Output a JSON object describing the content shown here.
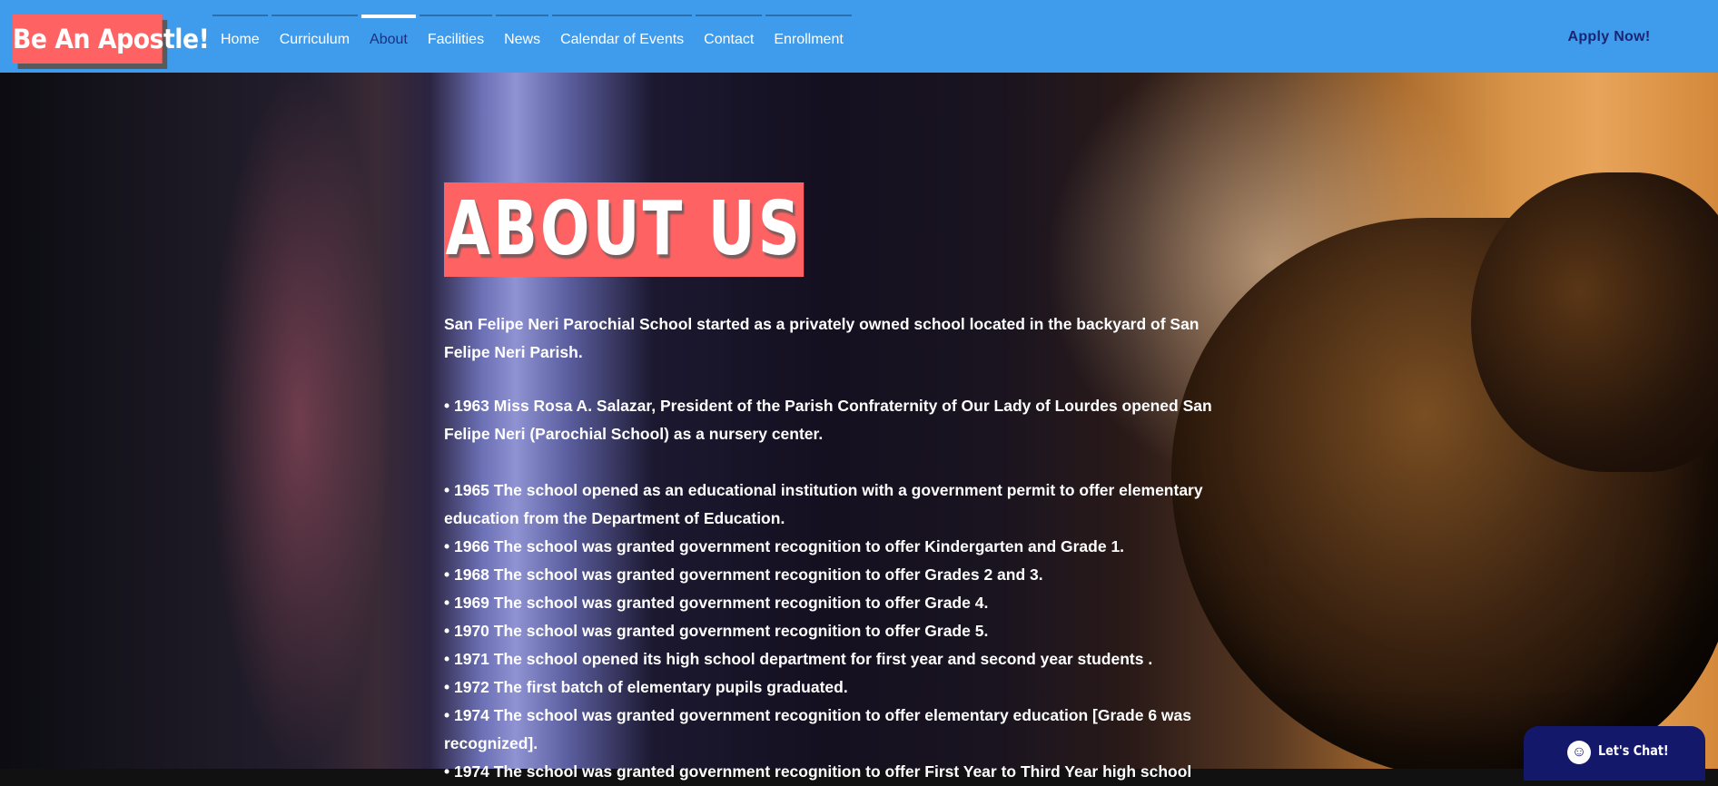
{
  "header": {
    "logo_text": "Be An Apostle!",
    "nav": [
      {
        "label": "Home"
      },
      {
        "label": "Curriculum"
      },
      {
        "label": "About"
      },
      {
        "label": "Facilities"
      },
      {
        "label": "News"
      },
      {
        "label": "Calendar of Events"
      },
      {
        "label": "Contact"
      },
      {
        "label": "Enrollment"
      }
    ],
    "active_tab": "About",
    "apply_label": "Apply Now!"
  },
  "colors": {
    "header_bg": "#3f9beb",
    "accent": "#ff6262",
    "apply_text": "#1c2474",
    "chat_bg": "#14186b"
  },
  "main": {
    "title": "ABOUT US",
    "intro": "San Felipe Neri Parochial School started as a privately owned school located in the backyard of San Felipe Neri Parish.",
    "paragraph_1963": "• 1963 Miss Rosa A. Salazar, President of the Parish Confraternity of Our Lady of Lourdes opened San Felipe Neri (Parochial School) as a nursery center.",
    "timeline": [
      "• 1965 The school opened as an educational institution with a government permit to offer elementary education from the Department of Education.",
      "• 1966 The school was granted government recognition to offer Kindergarten and Grade 1.",
      "• 1968 The school was granted government recognition to offer Grades 2 and 3.",
      "• 1969 The school was granted government recognition to offer Grade 4.",
      "• 1970 The school was granted government recognition to offer Grade 5.",
      "• 1971 The school opened its high school department for first year and second year students .",
      "• 1972 The first batch of elementary pupils graduated.",
      "• 1974 The school was granted government recognition to offer elementary education [Grade 6 was recognized].",
      "• 1974 The school was granted government recognition to offer First Year to Third Year high school"
    ]
  },
  "chat": {
    "label": "Let's Chat!",
    "icon": "smiley-icon"
  }
}
